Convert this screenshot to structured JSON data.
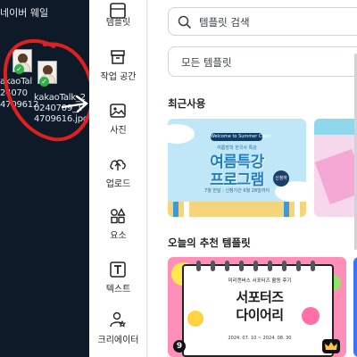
{
  "desktop": {
    "top_label": "네이버 웨일",
    "file_labels": [
      "akaoTal",
      "24070",
      "4709612",
      "kakaoTalk_2",
      "0240709_1",
      "4709616.jpg"
    ]
  },
  "rail": {
    "items": [
      {
        "label": "템플릿",
        "icon": "template-icon",
        "active": true
      },
      {
        "label": "작업 공간",
        "icon": "folder-icon"
      },
      {
        "label": "사진",
        "icon": "image-icon"
      },
      {
        "label": "업로드",
        "icon": "upload-icon"
      },
      {
        "label": "요소",
        "icon": "elements-icon"
      },
      {
        "label": "텍스트",
        "icon": "text-icon"
      },
      {
        "label": "크리에이터",
        "icon": "creator-icon"
      }
    ]
  },
  "panel": {
    "search_placeholder": "템플릿 검색",
    "filter_label": "모든 템플릿",
    "recent_title": "최근사용",
    "recommended_title": "오늘의 추천 템플릿",
    "page_count_badge": "9"
  },
  "cards": {
    "summer": {
      "badge": "Welcome to Summer Class",
      "small": "여름방학 한국사 특강",
      "title_line1": "여름특강",
      "title_line2": "프로그램",
      "sub": "7월 한달 : 신청기간 6월 28일까지",
      "go": "신청하기"
    },
    "notebook": {
      "small": "미리캔버스 서포터즈 활동 후기",
      "title_line1": "서포터즈",
      "title_line2": "다이어리",
      "footer": "2024. 07. 10 ~ 2024. 08. 30"
    }
  },
  "colors": {
    "accent": "#1b7fc6",
    "desktop_bg": "#0f1a28",
    "annotation": "#e02020",
    "pink_card": "#ff8fb8"
  }
}
